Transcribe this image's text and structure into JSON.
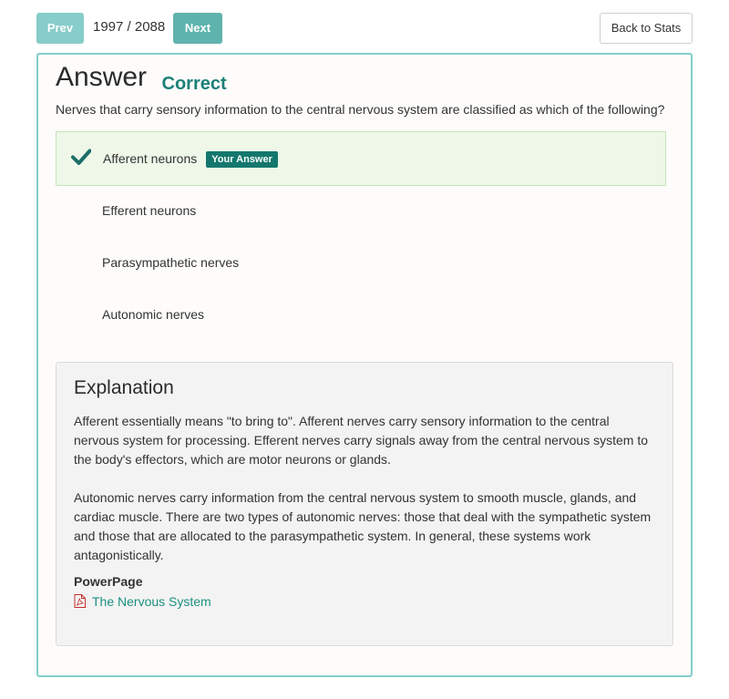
{
  "nav": {
    "prev_label": "Prev",
    "counter": "1997 / 2088",
    "next_label": "Next",
    "back_label": "Back to Stats"
  },
  "answer": {
    "title": "Answer",
    "status": "Correct",
    "question": "Nerves that carry sensory information to the central nervous system are classified as which of the following?",
    "your_answer_badge": "Your Answer",
    "options": [
      {
        "label": "Afferent neurons",
        "selected": true,
        "correct": true
      },
      {
        "label": "Efferent neurons",
        "selected": false
      },
      {
        "label": "Parasympathetic nerves",
        "selected": false
      },
      {
        "label": "Autonomic nerves",
        "selected": false
      }
    ]
  },
  "explanation": {
    "title": "Explanation",
    "para1": "Afferent essentially means \"to bring to\". Afferent nerves carry sensory information to the central nervous system for processing. Efferent nerves carry signals away from the central nervous system to the body's effectors, which are motor neurons or glands.",
    "para2": "Autonomic nerves carry information from the central nervous system to smooth muscle, glands, and cardiac muscle. There are two types of autonomic nerves: those that deal with the sympathetic system and those that are allocated to the parasympathetic system. In general, these systems work antagonistically.",
    "powerpage_label": "PowerPage",
    "link_text": "The Nervous System",
    "link_icon": "pdf-icon"
  },
  "colors": {
    "accent": "#82cfc9",
    "correct": "#1c8077",
    "link": "#1c8f80",
    "badge": "#14776d"
  }
}
